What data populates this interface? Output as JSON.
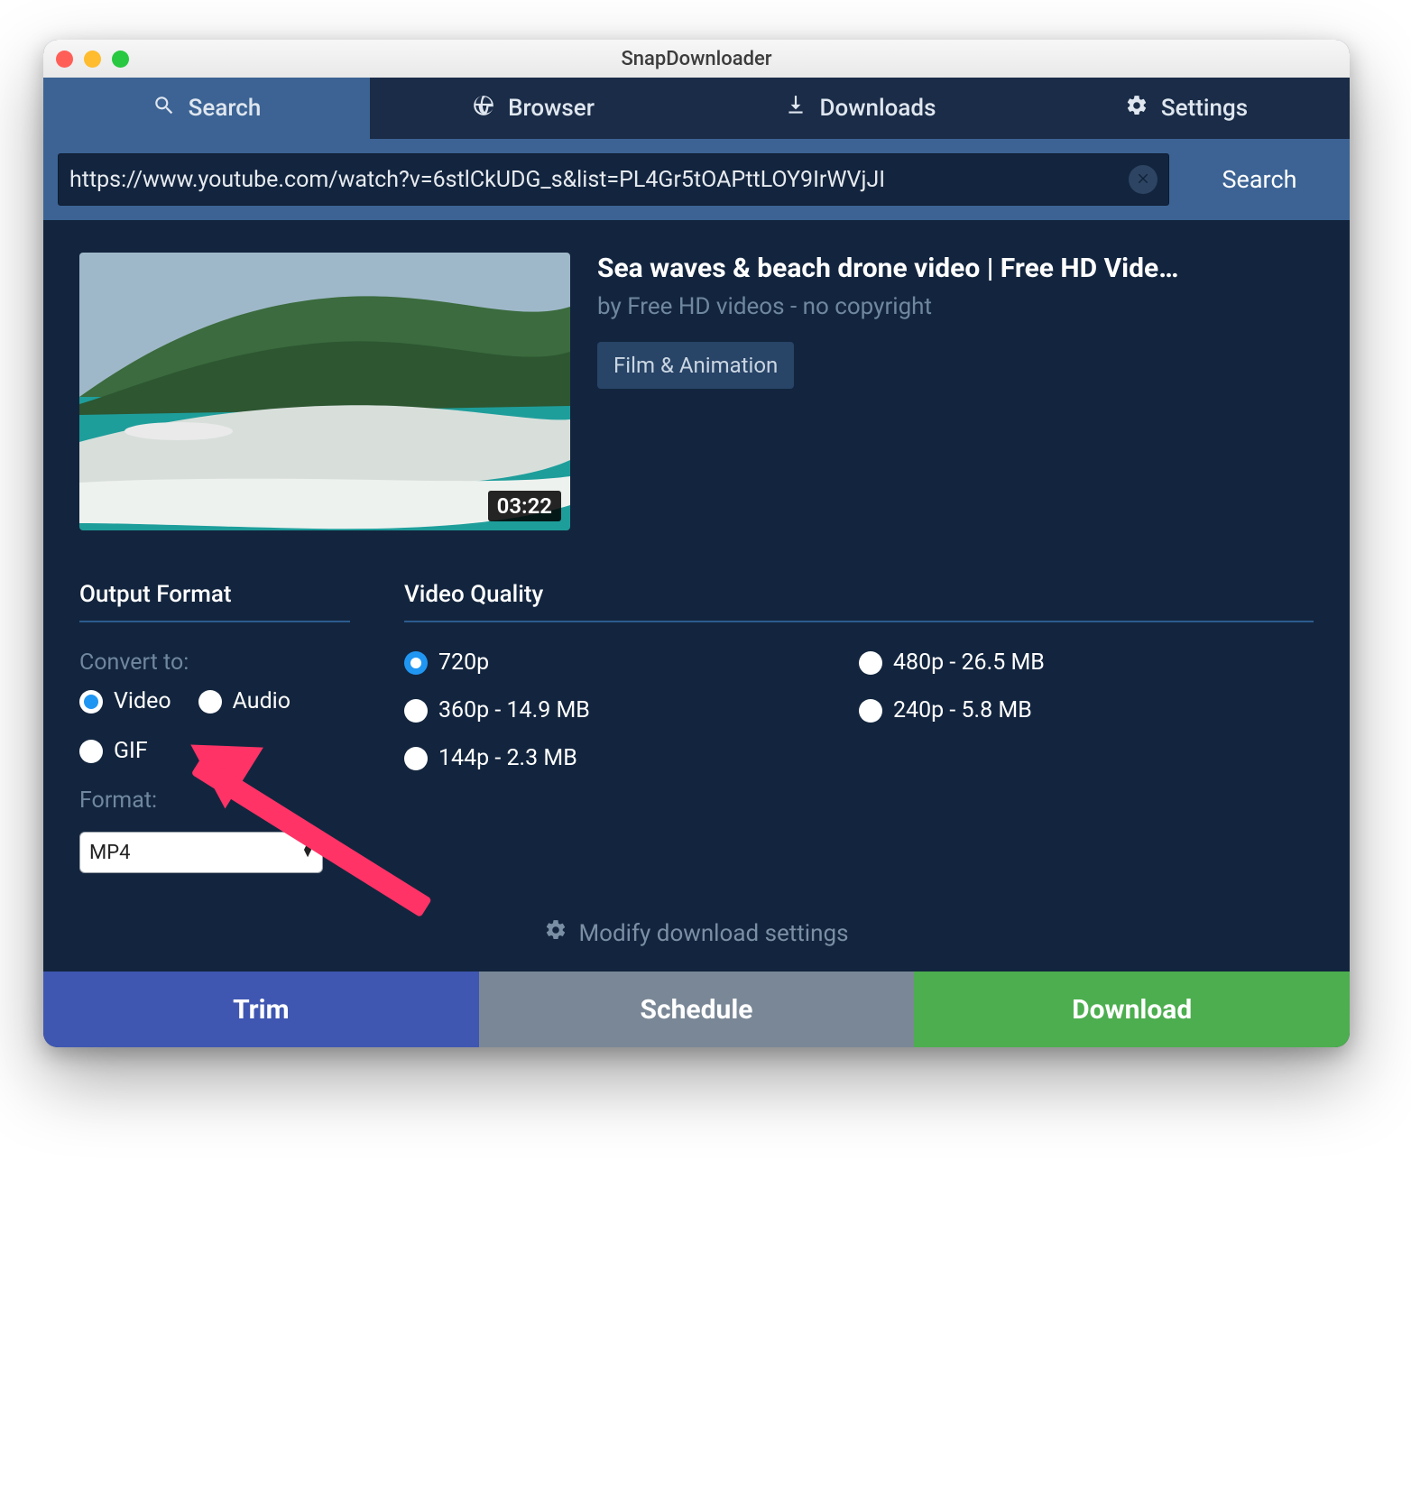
{
  "window": {
    "title": "SnapDownloader"
  },
  "tabs": {
    "search": "Search",
    "browser": "Browser",
    "downloads": "Downloads",
    "settings": "Settings"
  },
  "searchbar": {
    "url": "https://www.youtube.com/watch?v=6stlCkUDG_s&list=PL4Gr5tOAPttLOY9IrWVjJI",
    "search_button": "Search"
  },
  "video": {
    "title": "Sea waves & beach drone video | Free HD Vide…",
    "author_prefix": "by ",
    "author": "Free HD videos - no copyright",
    "category": "Film & Animation",
    "duration": "03:22"
  },
  "output_format": {
    "heading": "Output Format",
    "convert_label": "Convert to:",
    "options": {
      "video": "Video",
      "audio": "Audio",
      "gif": "GIF"
    },
    "selected": "video",
    "format_label": "Format:",
    "format_selected": "MP4"
  },
  "video_quality": {
    "heading": "Video Quality",
    "options": [
      {
        "label": "720p",
        "selected": true
      },
      {
        "label": "480p - 26.5 MB",
        "selected": false
      },
      {
        "label": "360p - 14.9 MB",
        "selected": false
      },
      {
        "label": "240p - 5.8 MB",
        "selected": false
      },
      {
        "label": "144p - 2.3 MB",
        "selected": false
      }
    ]
  },
  "modify_settings": "Modify download settings",
  "actions": {
    "trim": "Trim",
    "schedule": "Schedule",
    "download": "Download"
  }
}
